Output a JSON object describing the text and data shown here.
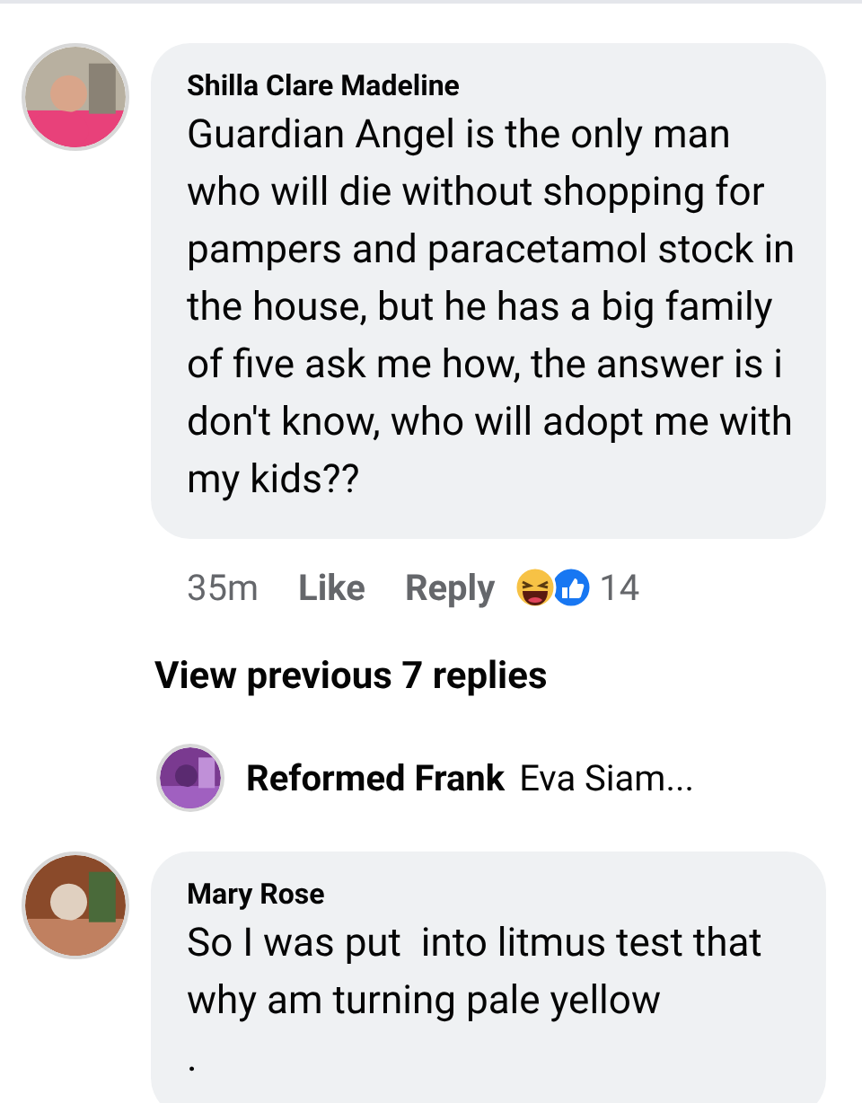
{
  "comments": [
    {
      "kind": "comment",
      "author": "Shilla Clare Madeline",
      "text": "Guardian Angel is the only man who will die without shopping for pampers and paracetamol stock in the house, but he has a big family of five ask me how, the answer is i don't know, who will adopt me with my kids??",
      "time": "35m",
      "actions": [
        "Like",
        "Reply"
      ],
      "reaction_count": "14"
    },
    {
      "kind": "more",
      "label": "View previous 7 replies"
    },
    {
      "kind": "reply",
      "author": "Reformed Frank",
      "text": "Eva Siam..."
    },
    {
      "kind": "comment",
      "author": "Mary Rose",
      "text": "So I was put  into litmus test that why am turning pale yellow\n."
    }
  ]
}
